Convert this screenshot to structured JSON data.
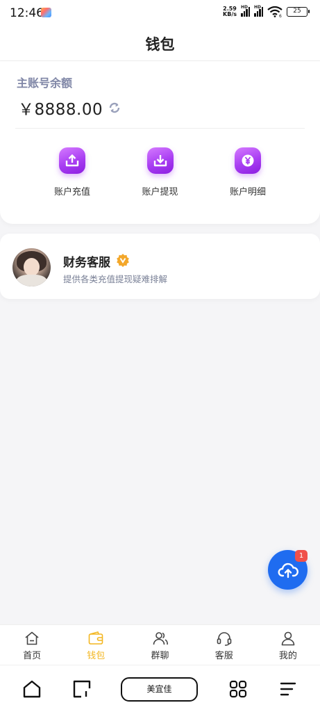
{
  "status_bar": {
    "time": "12:46",
    "net_speed_value": "2.59",
    "net_speed_unit": "KB/s",
    "signal_1_label": "HD",
    "signal_2_label": "HD",
    "wifi_label": "6",
    "battery": "25"
  },
  "header": {
    "title": "钱包"
  },
  "wallet": {
    "balance_label": "主账号余额",
    "balance_value": "￥8888.00",
    "actions": [
      {
        "label": "账户充值",
        "icon": "upload-tray-icon"
      },
      {
        "label": "账户提现",
        "icon": "download-tray-icon"
      },
      {
        "label": "账户明细",
        "icon": "yen-coin-icon"
      }
    ]
  },
  "service": {
    "name": "财务客服",
    "description": "提供各类充值提现疑难排解",
    "verified_icon": "verified-badge-icon"
  },
  "fab": {
    "badge": "1",
    "icon": "cloud-upload-icon"
  },
  "tab_bar": {
    "tabs": [
      {
        "label": "首页",
        "icon": "home-icon"
      },
      {
        "label": "钱包",
        "icon": "wallet-icon"
      },
      {
        "label": "群聊",
        "icon": "group-icon"
      },
      {
        "label": "客服",
        "icon": "headset-icon"
      },
      {
        "label": "我的",
        "icon": "profile-icon"
      }
    ],
    "active_index": 1
  },
  "system_nav": {
    "center_label": "美宜佳"
  },
  "colors": {
    "accent_purple": "#a83df2",
    "active_tab": "#f3b61f",
    "fab_blue": "#1f6cf0",
    "badge_red": "#f0504a",
    "label_gray": "#7f86a6"
  }
}
